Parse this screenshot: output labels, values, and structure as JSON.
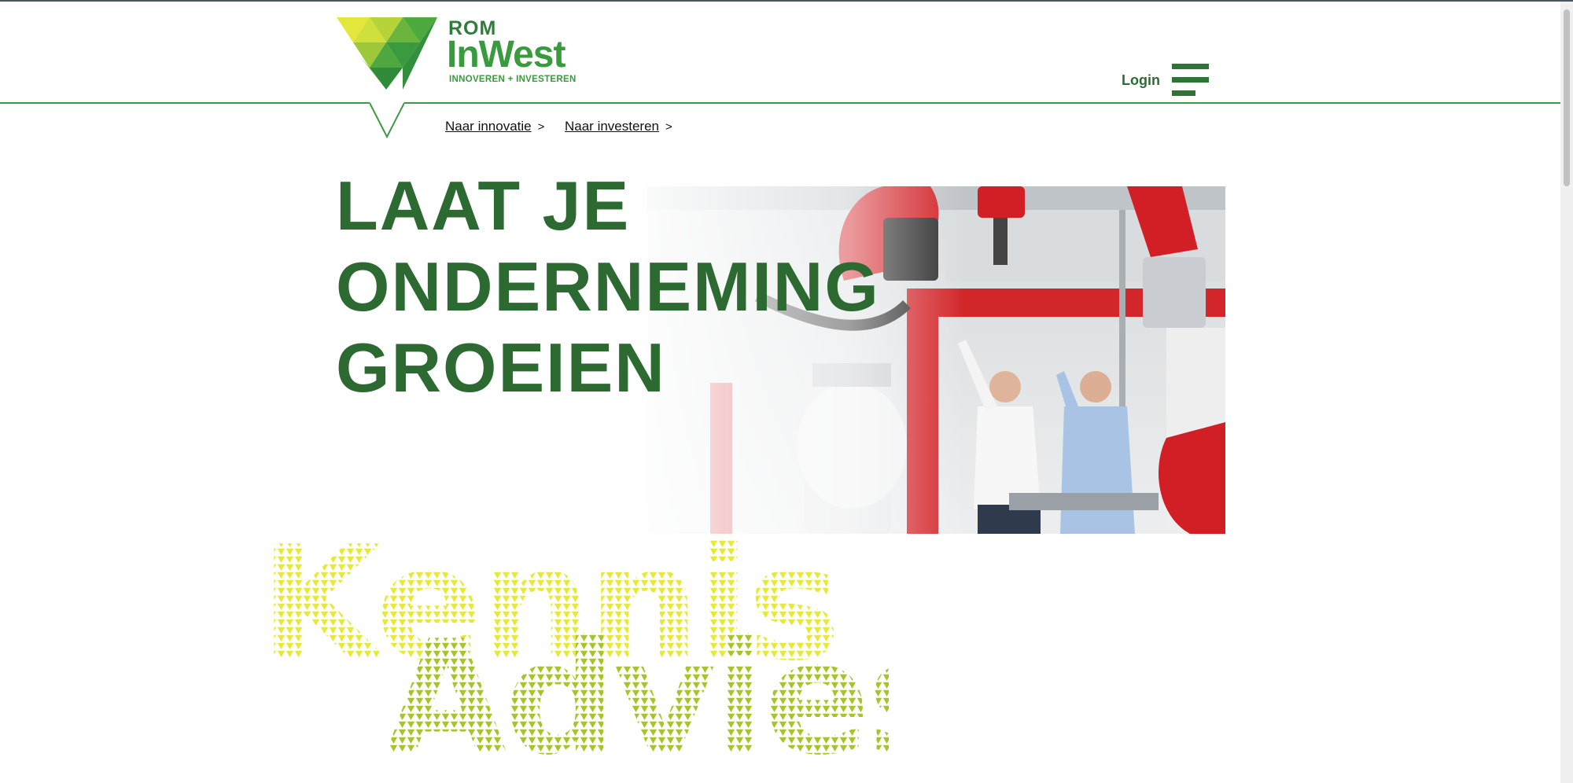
{
  "brand": {
    "line1": "ROM",
    "line2": "InWest",
    "tagline": "INNOVEREN + INVESTEREN",
    "colors": {
      "dark_green": "#2c6a32",
      "green": "#3a9a3e",
      "lime": "#a7c42e",
      "yellow": "#e6e83a"
    }
  },
  "header": {
    "login_label": "Login",
    "menu_icon": "hamburger-icon"
  },
  "subnav": [
    {
      "label": "Naar innovatie",
      "chevron": ">"
    },
    {
      "label": "Naar investeren",
      "chevron": ">"
    }
  ],
  "hero": {
    "title_lines": [
      "LAAT JE",
      "ONDERNEMING",
      "GROEIEN"
    ],
    "image": "photo-two-engineers-with-red-industrial-robots"
  },
  "section_art": {
    "word1": "Kennis",
    "word2": "Advies"
  }
}
